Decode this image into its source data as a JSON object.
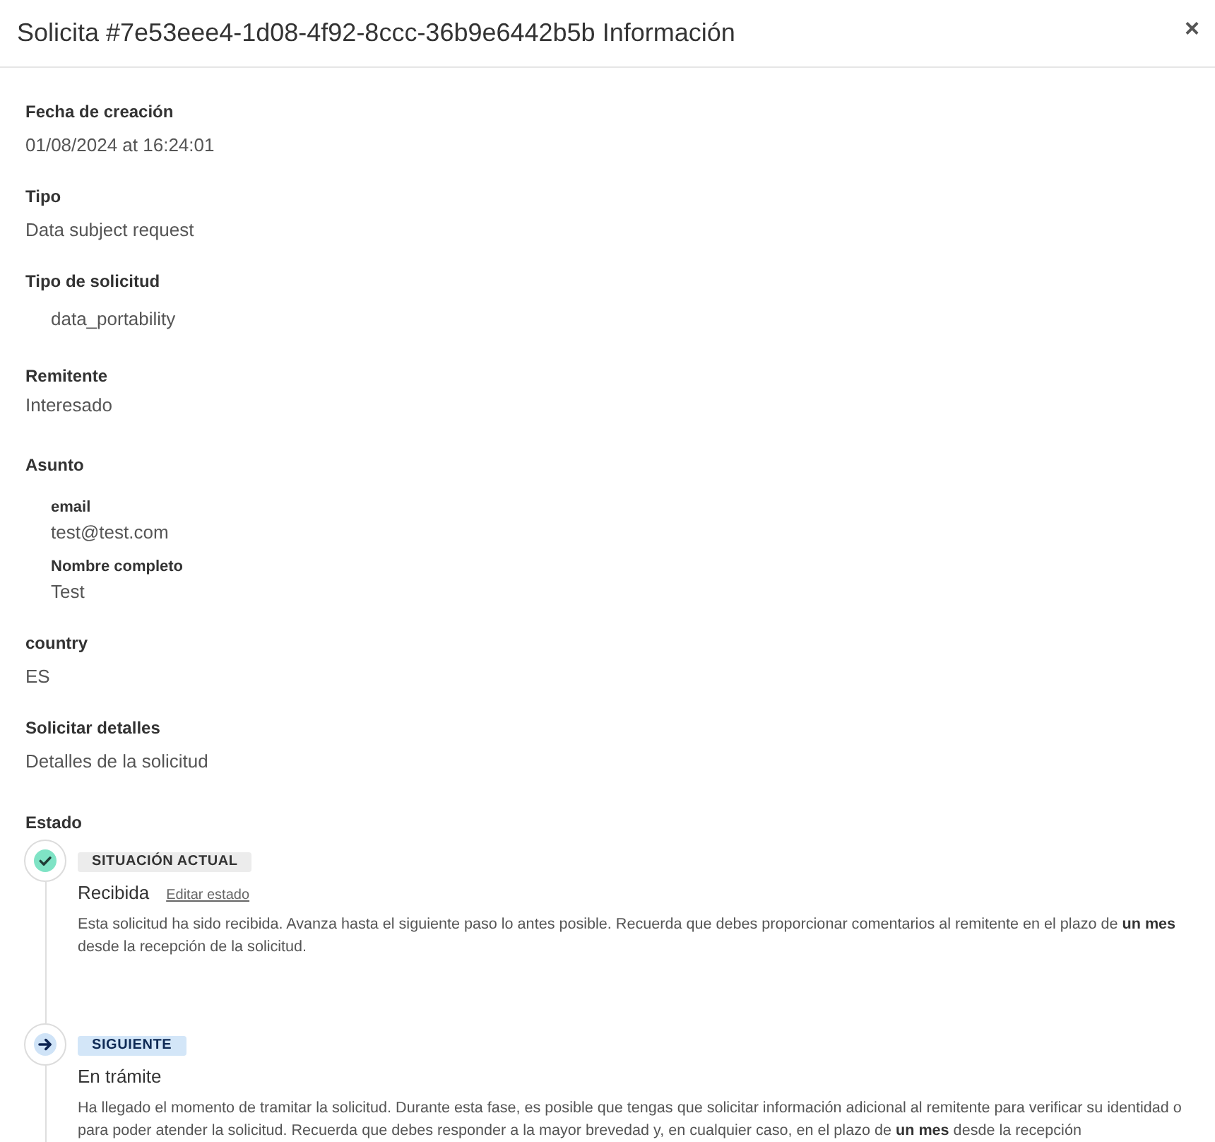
{
  "dialog": {
    "title": "Solicita #7e53eee4-1d08-4f92-8ccc-36b9e6442b5b Información",
    "close": "×"
  },
  "fields": [
    {
      "kind": "plain",
      "label": "Fecha de creación",
      "value": "01/08/2024 at 16:24:01"
    },
    {
      "kind": "plain",
      "label": "Tipo",
      "value": "Data subject request"
    },
    {
      "kind": "indented",
      "label": "Tipo de solicitud",
      "value": "data_portability"
    },
    {
      "kind": "plain",
      "label": "Remitente",
      "value": "Interesado"
    },
    {
      "kind": "group",
      "label": "Asunto",
      "children": [
        {
          "label": "email",
          "value": "test@test.com"
        },
        {
          "label": "Nombre completo",
          "value": "Test"
        }
      ]
    },
    {
      "kind": "plain",
      "label": "country",
      "value": "ES"
    },
    {
      "kind": "plain",
      "label": "Solicitar detalles",
      "value": "Detalles de la solicitud"
    }
  ],
  "status": {
    "label": "Estado",
    "steps": [
      {
        "kind": "current",
        "badge": "SITUACIÓN ACTUAL",
        "name": "Recibida",
        "link": "Editar estado",
        "description": "Esta solicitud ha sido recibida. Avanza hasta el siguiente paso lo antes posible. Recuerda que debes proporcionar comentarios al remitente en el plazo de **un mes** desde la recepción de la solicitud."
      },
      {
        "kind": "next",
        "badge": "SIGUIENTE",
        "name": "En trámite",
        "description": "Ha llegado el momento de tramitar la solicitud. Durante esta fase, es posible que tengas que solicitar información adicional al remitente para verificar su identidad o para poder atender la solicitud. Recuerda que debes responder a la mayor brevedad y, en cualquier caso, en el plazo de **un mes** desde la recepción"
      }
    ]
  }
}
